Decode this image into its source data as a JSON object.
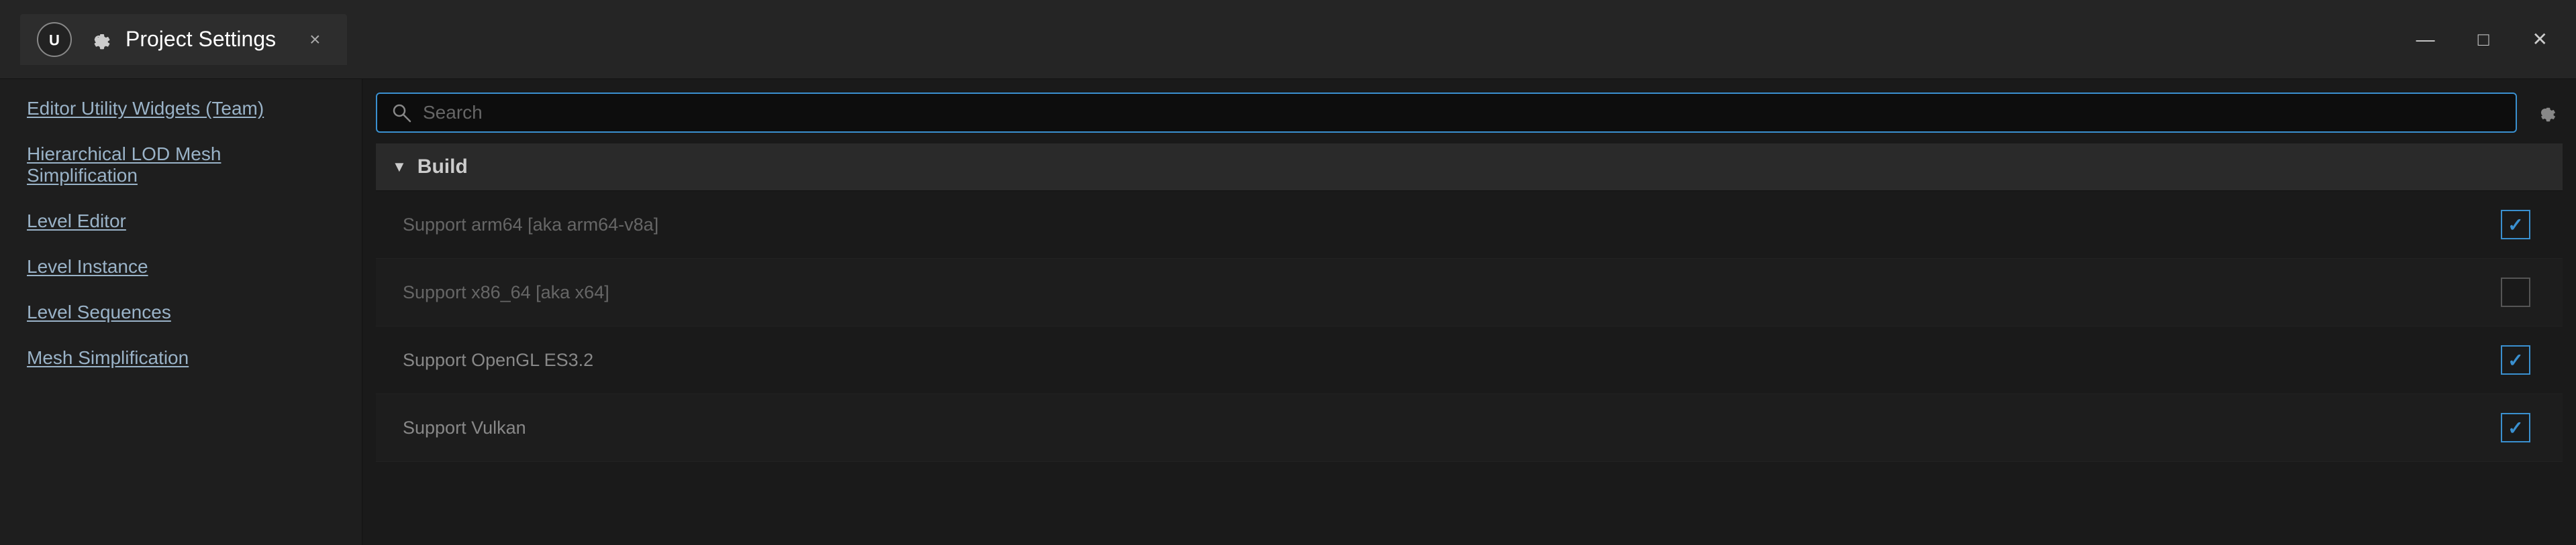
{
  "titleBar": {
    "title": "Project Settings",
    "closeLabel": "×",
    "windowControls": {
      "minimize": "—",
      "maximize": "□",
      "close": "✕"
    }
  },
  "sidebar": {
    "items": [
      {
        "label": "Editor Utility Widgets (Team)"
      },
      {
        "label": "Hierarchical LOD Mesh Simplification"
      },
      {
        "label": "Level Editor"
      },
      {
        "label": "Level Instance"
      },
      {
        "label": "Level Sequences"
      },
      {
        "label": "Mesh Simplification"
      }
    ]
  },
  "search": {
    "placeholder": "Search"
  },
  "sections": [
    {
      "title": "Build",
      "rows": [
        {
          "label": "Support arm64 [aka arm64-v8a]",
          "checked": true,
          "dimLabel": true
        },
        {
          "label": "Support x86_64 [aka x64]",
          "checked": false,
          "dimLabel": true
        },
        {
          "label": "Support OpenGL ES3.2",
          "checked": true,
          "dimLabel": false
        },
        {
          "label": "Support Vulkan",
          "checked": true,
          "dimLabel": false
        }
      ]
    }
  ]
}
